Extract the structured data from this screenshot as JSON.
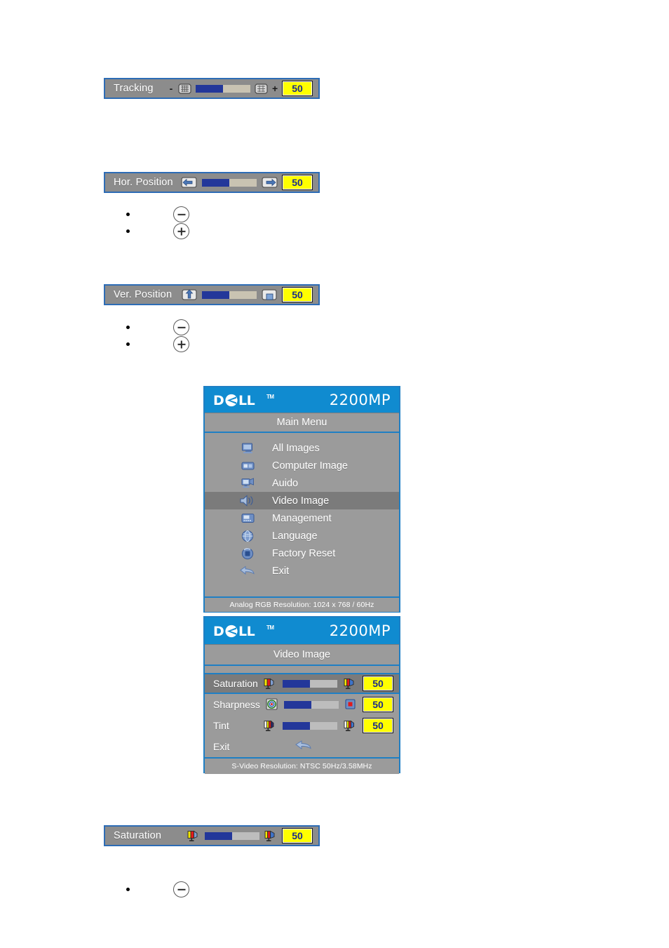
{
  "adjustment_bars": [
    {
      "id": "tracking",
      "label": "Tracking",
      "value": "50",
      "minus_sign": "-",
      "plus_sign": "+",
      "left_icon": "tracking-grid-icon",
      "right_icon": "tracking-grid-icon",
      "fill_percent": 50
    },
    {
      "id": "hor-position",
      "label": "Hor. Position",
      "value": "50",
      "left_icon": "arrow-left-box-icon",
      "right_icon": "arrow-right-box-icon",
      "fill_percent": 50
    },
    {
      "id": "ver-position",
      "label": "Ver. Position",
      "value": "50",
      "left_icon": "arrow-up-box-icon",
      "right_icon": "arrow-down-box-icon",
      "fill_percent": 50
    },
    {
      "id": "saturation",
      "label": "Saturation",
      "value": "50",
      "left_icon": "color-swatch-low-icon",
      "right_icon": "color-swatch-high-icon",
      "fill_percent": 50
    }
  ],
  "glyph_rows": [
    {
      "id": "hor-minus",
      "bullet": true,
      "glyph": "minus-circle-icon"
    },
    {
      "id": "hor-plus",
      "bullet": true,
      "glyph": "plus-circle-icon"
    },
    {
      "id": "ver-minus",
      "bullet": true,
      "glyph": "minus-circle-icon"
    },
    {
      "id": "ver-plus",
      "bullet": true,
      "glyph": "plus-circle-icon"
    },
    {
      "id": "sat-minus",
      "bullet": true,
      "glyph": "minus-circle-icon"
    }
  ],
  "main_menu_panel": {
    "brand": "DELL",
    "brand_tm": "TM",
    "model": "2200MP",
    "title": "Main Menu",
    "items": [
      {
        "label": "All Images",
        "icon": "monitor-image-icon",
        "selected": false
      },
      {
        "label": "Computer Image",
        "icon": "computer-image-icon",
        "selected": false
      },
      {
        "label": "Auido",
        "icon": "audio-monitor-icon",
        "selected": false
      },
      {
        "label": "Video Image",
        "icon": "speaker-video-icon",
        "selected": true
      },
      {
        "label": "Management",
        "icon": "management-icon",
        "selected": false
      },
      {
        "label": "Language",
        "icon": "globe-language-icon",
        "selected": false
      },
      {
        "label": "Factory Reset",
        "icon": "factory-reset-icon",
        "selected": false
      },
      {
        "label": "Exit",
        "icon": "exit-arrow-icon",
        "selected": false
      }
    ],
    "footer": "Analog RGB Resolution: 1024 x 768 / 60Hz"
  },
  "video_image_panel": {
    "brand": "DELL",
    "brand_tm": "TM",
    "model": "2200MP",
    "title": "Video Image",
    "rows": [
      {
        "label": "Saturation",
        "value": "50",
        "left_icon": "color-swatch-low-icon",
        "right_icon": "color-swatch-high-icon",
        "fill_percent": 50,
        "selected": true,
        "type": "slider"
      },
      {
        "label": "Sharpness",
        "value": "50",
        "left_icon": "sharpness-target-icon",
        "right_icon": "sharpness-square-icon",
        "fill_percent": 50,
        "selected": false,
        "type": "slider"
      },
      {
        "label": "Tint",
        "value": "50",
        "left_icon": "tint-swatch-left-icon",
        "right_icon": "tint-swatch-right-icon",
        "fill_percent": 50,
        "selected": false,
        "type": "slider"
      },
      {
        "label": "Exit",
        "value": "",
        "icon": "exit-arrow-icon",
        "selected": false,
        "type": "action"
      }
    ],
    "footer": "S-Video Resolution: NTSC 50Hz/3.58MHz"
  },
  "colors": {
    "panel_border": "#1f7fc4",
    "panel_bg": "#9b9b9b",
    "header_blue": "#108bd0",
    "slider_fill": "#23379a",
    "slider_track": "#c9c3b2",
    "value_yellow": "#ffff00",
    "value_text": "#1c2d8a",
    "selected_row": "#7b7b7b"
  }
}
